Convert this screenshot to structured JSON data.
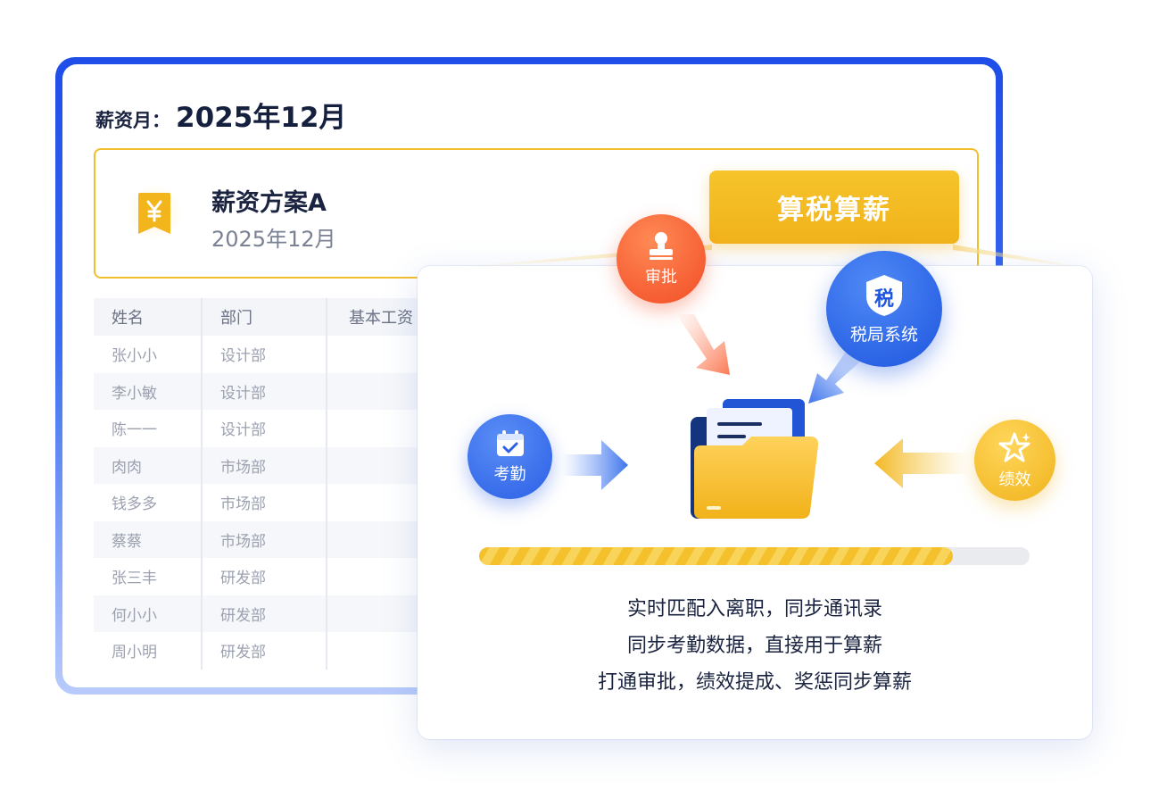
{
  "payroll": {
    "month_label": "薪资月：",
    "month_value": "2025年12月"
  },
  "plan": {
    "name": "薪资方案A",
    "date": "2025年12月",
    "icon": "yen-ticket-icon"
  },
  "table": {
    "headers": [
      "姓名",
      "部门",
      "基本工资"
    ],
    "rows": [
      {
        "name": "张小小",
        "dept": "设计部"
      },
      {
        "name": "李小敏",
        "dept": "设计部"
      },
      {
        "name": "陈一一",
        "dept": "设计部"
      },
      {
        "name": "肉肉",
        "dept": "市场部"
      },
      {
        "name": "钱多多",
        "dept": "市场部"
      },
      {
        "name": "蔡蔡",
        "dept": "市场部"
      },
      {
        "name": "张三丰",
        "dept": "研发部"
      },
      {
        "name": "何小小",
        "dept": "研发部"
      },
      {
        "name": "周小明",
        "dept": "研发部"
      }
    ]
  },
  "cta": {
    "label": "算税算薪"
  },
  "sources": {
    "approve": {
      "label": "审批",
      "icon": "stamp-icon",
      "color": "#f24c26"
    },
    "tax": {
      "label": "税局系统",
      "badge": "税",
      "icon": "shield-icon",
      "color": "#1e55df"
    },
    "attend": {
      "label": "考勤",
      "icon": "calendar-check-icon",
      "color": "#2a5fe6"
    },
    "perf": {
      "label": "绩效",
      "icon": "star-icon",
      "color": "#f0b31d"
    }
  },
  "progress": {
    "value": 0.86
  },
  "features": [
    "实时匹配入离职，同步通讯录",
    "同步考勤数据，直接用于算薪",
    "打通审批，绩效提成、奖惩同步算薪"
  ],
  "colors": {
    "brand_blue": "#1f4de8",
    "accent_yellow": "#f1b21a"
  }
}
